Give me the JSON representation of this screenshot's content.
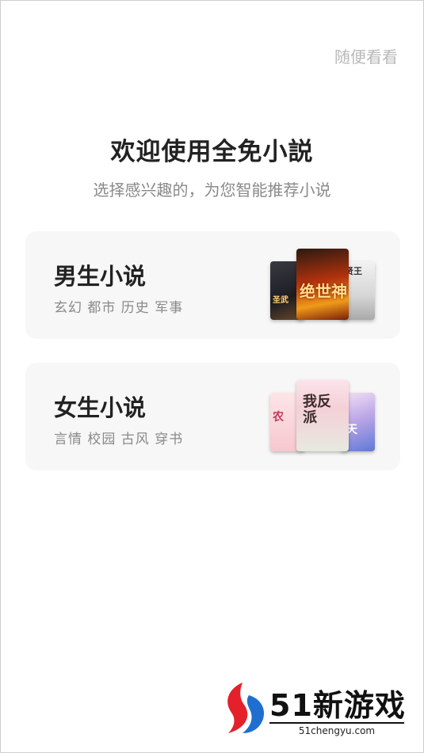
{
  "header": {
    "skip_label": "随便看看"
  },
  "welcome": {
    "title": "欢迎使用全免小説",
    "subtitle": "选择感兴趣的，为您智能推荐小说"
  },
  "categories": [
    {
      "title": "男生小说",
      "tags": "玄幻 都市 历史 军事",
      "covers": [
        "圣武",
        "绝世神",
        "贤王"
      ]
    },
    {
      "title": "女生小说",
      "tags": "言情 校园 古风 穿书",
      "covers": [
        "农",
        "我反派",
        "天"
      ]
    }
  ],
  "watermark": {
    "brand": "51新游戏",
    "url": "51chengyu.com"
  },
  "colors": {
    "accent_red": "#e4202b",
    "accent_blue": "#1f6fd1",
    "card_bg": "#f7f7f7"
  }
}
